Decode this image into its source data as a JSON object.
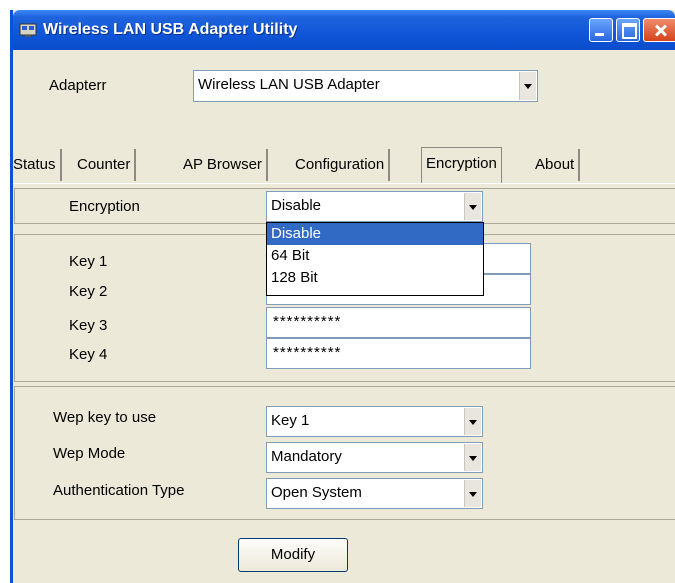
{
  "window": {
    "title": "Wireless LAN USB Adapter Utility",
    "icon": "network-adapter-icon",
    "controls": [
      "minimize-icon",
      "maximize-icon",
      "close-icon"
    ]
  },
  "adapter": {
    "label": "Adapterr",
    "value": "Wireless LAN USB Adapter"
  },
  "tabs": [
    {
      "label": "Status"
    },
    {
      "label": "Counter"
    },
    {
      "label": "AP Browser"
    },
    {
      "label": "Configuration"
    },
    {
      "label": "Encryption",
      "active": true
    },
    {
      "label": "About"
    }
  ],
  "encryption": {
    "label": "Encryption",
    "value": "Disable",
    "options": [
      "Disable",
      "64 Bit",
      "128 Bit"
    ],
    "highlighted": "Disable"
  },
  "keys": [
    {
      "label": "Key 1",
      "value": ""
    },
    {
      "label": "Key 2",
      "value": ""
    },
    {
      "label": "Key 3",
      "value": "**********"
    },
    {
      "label": "Key 4",
      "value": "**********"
    }
  ],
  "wep_key_to_use": {
    "label": "Wep key to use",
    "value": "Key 1"
  },
  "wep_mode": {
    "label": "Wep Mode",
    "value": "Mandatory"
  },
  "auth_type": {
    "label": "Authentication Type",
    "value": "Open System"
  },
  "modify_label": "Modify",
  "colors": {
    "titlebar": "#0a4ccc",
    "dialog": "#ece9d8",
    "selection": "#316ac5"
  }
}
